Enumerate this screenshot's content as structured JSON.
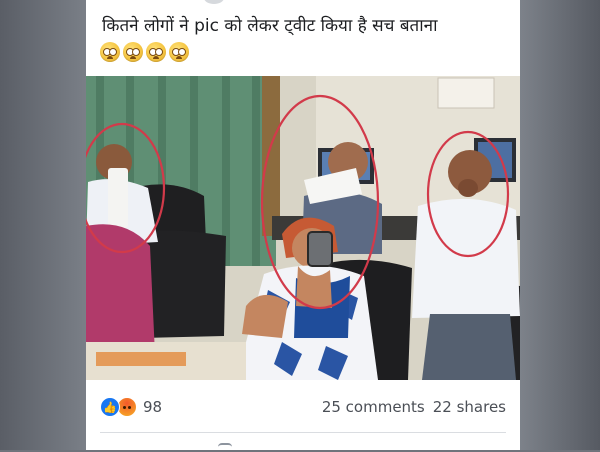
{
  "post": {
    "caption": "कितने लोगों ने pic को लेकर ट्वीट किया है सच बताना",
    "emoji_icons": [
      "dizzy-face-icon",
      "dizzy-face-icon",
      "dizzy-face-icon",
      "dizzy-face-icon"
    ]
  },
  "footer": {
    "reaction_icons": [
      "like-icon",
      "angry-icon"
    ],
    "reaction_count": "98",
    "comments": "25 comments",
    "shares": "22 shares"
  },
  "colors": {
    "like_blue": "#1877f2",
    "annotation_circle": "#d23a4a",
    "card_bg": "#ffffff",
    "page_bg": "#6f747c"
  }
}
